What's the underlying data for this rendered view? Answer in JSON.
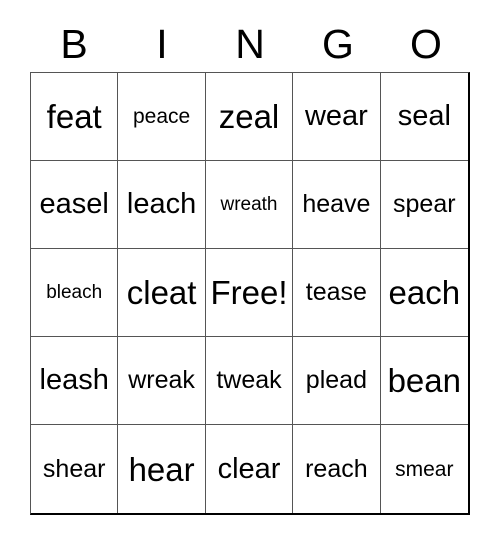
{
  "card": {
    "title": "BINGO",
    "header_letters": [
      "B",
      "I",
      "N",
      "G",
      "O"
    ],
    "free_space_label": "Free!",
    "colors": {
      "text": "#000000",
      "background": "#ffffff",
      "grid_line": "#555555",
      "outer_border": "#000000"
    },
    "grid": {
      "columns": 5,
      "rows": 5,
      "cells": [
        {
          "text": "feat",
          "size": "xl"
        },
        {
          "text": "peace",
          "size": "sm"
        },
        {
          "text": "zeal",
          "size": "xl"
        },
        {
          "text": "wear",
          "size": "lg"
        },
        {
          "text": "seal",
          "size": "lg"
        },
        {
          "text": "easel",
          "size": "lg"
        },
        {
          "text": "leach",
          "size": "lg"
        },
        {
          "text": "wreath",
          "size": "xs"
        },
        {
          "text": "heave",
          "size": "md"
        },
        {
          "text": "spear",
          "size": "md"
        },
        {
          "text": "bleach",
          "size": "xs"
        },
        {
          "text": "cleat",
          "size": "xl"
        },
        {
          "text": "Free!",
          "size": "xl"
        },
        {
          "text": "tease",
          "size": "md"
        },
        {
          "text": "each",
          "size": "xl"
        },
        {
          "text": "leash",
          "size": "lg"
        },
        {
          "text": "wreak",
          "size": "md"
        },
        {
          "text": "tweak",
          "size": "md"
        },
        {
          "text": "plead",
          "size": "md"
        },
        {
          "text": "bean",
          "size": "xl"
        },
        {
          "text": "shear",
          "size": "md"
        },
        {
          "text": "hear",
          "size": "xl"
        },
        {
          "text": "clear",
          "size": "lg"
        },
        {
          "text": "reach",
          "size": "md"
        },
        {
          "text": "smear",
          "size": "sm"
        }
      ]
    }
  }
}
